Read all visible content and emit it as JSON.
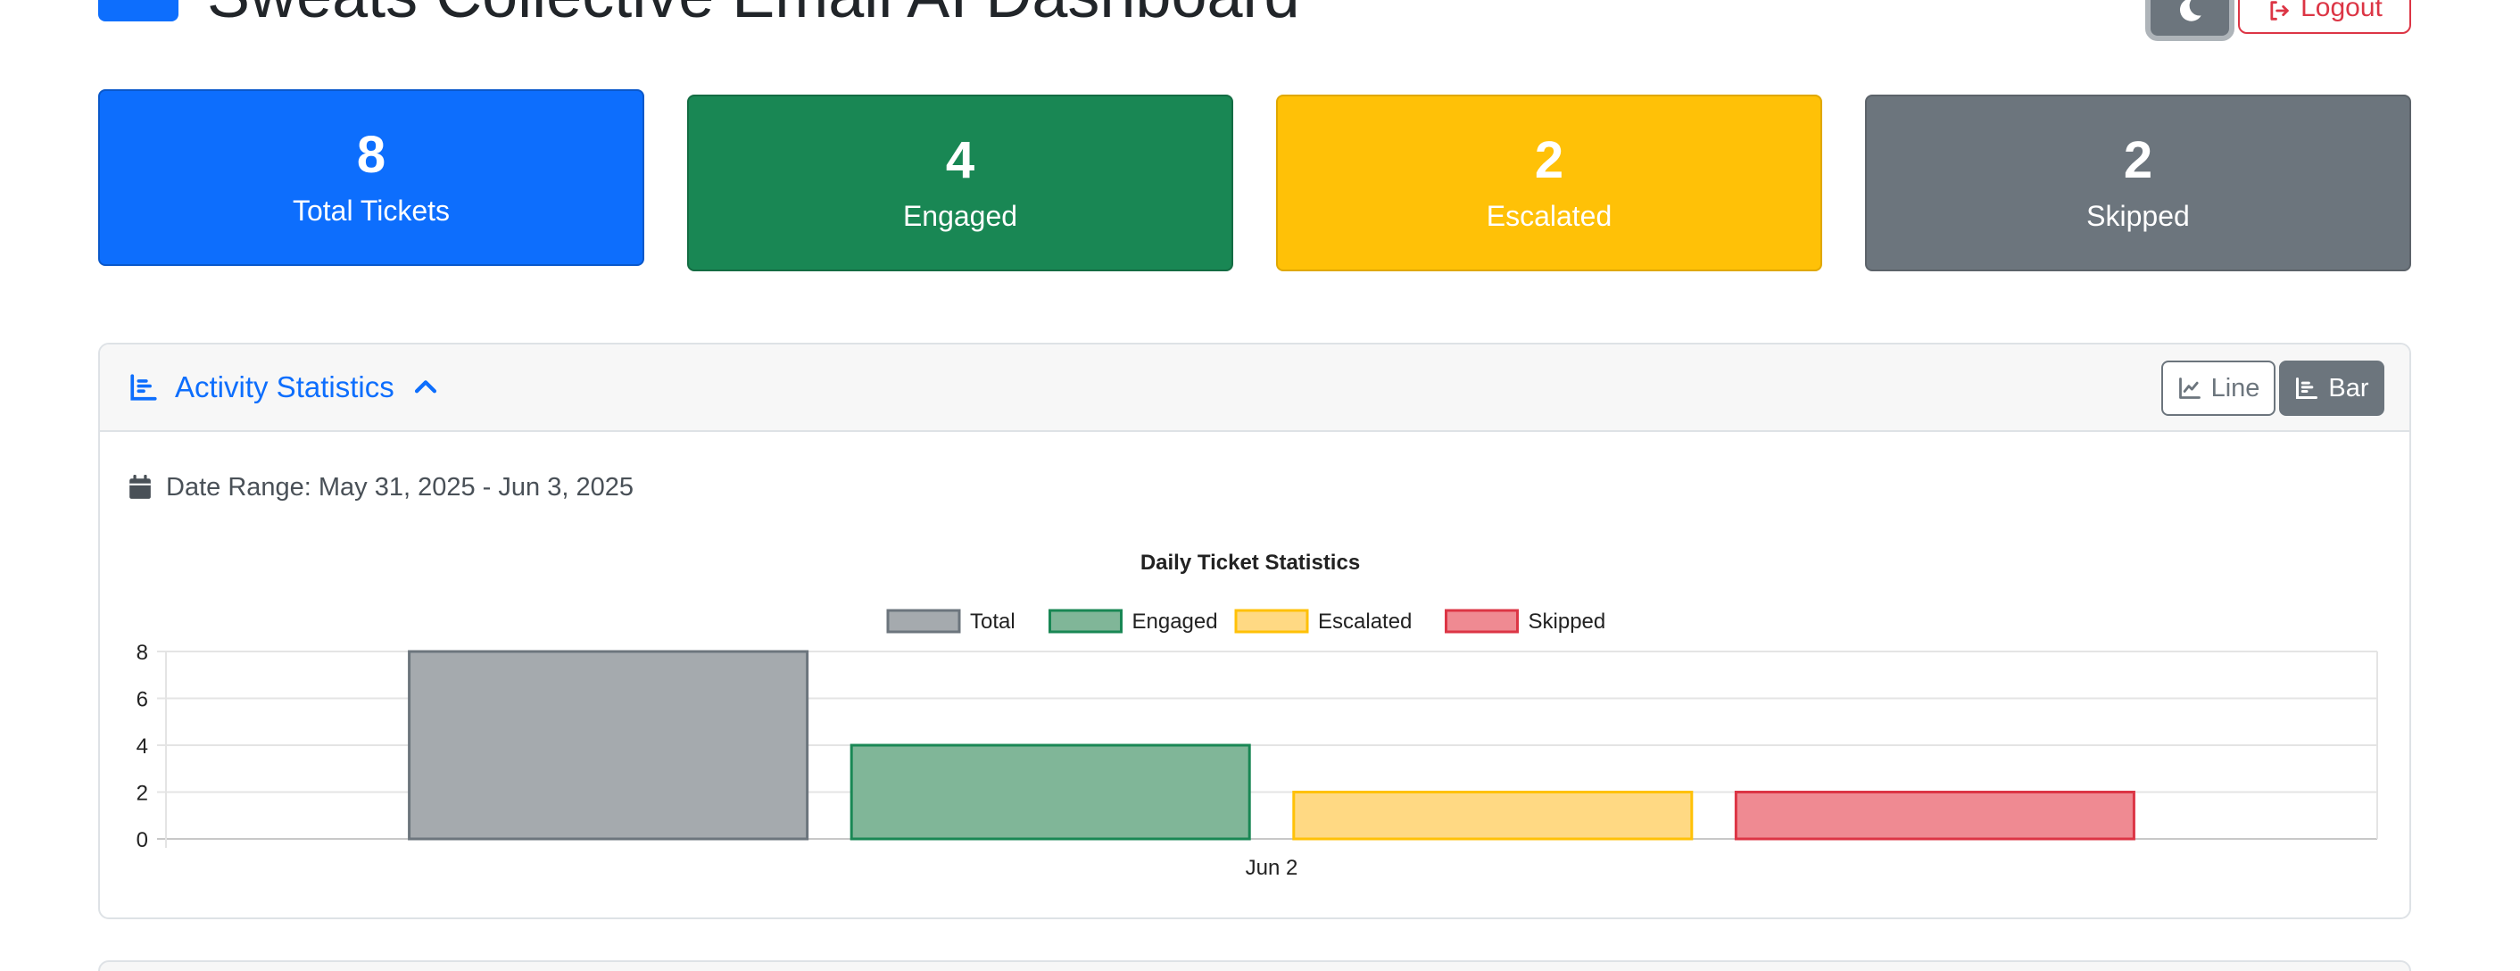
{
  "header": {
    "title": "Sweats Collective Email AI Dashboard",
    "logout_label": "Logout"
  },
  "stats": [
    {
      "value": "8",
      "label": "Total Tickets"
    },
    {
      "value": "4",
      "label": "Engaged"
    },
    {
      "value": "2",
      "label": "Escalated"
    },
    {
      "value": "2",
      "label": "Skipped"
    }
  ],
  "activity": {
    "title": "Activity Statistics",
    "line_label": "Line",
    "bar_label": "Bar",
    "date_range": "Date Range: May 31, 2025 - Jun 3, 2025"
  },
  "colors": {
    "primary": "#0d6efd",
    "success": "#198754",
    "warning": "#ffc107",
    "secondary": "#6c757d",
    "danger": "#dc3545"
  },
  "chart_data": {
    "type": "bar",
    "title": "Daily Ticket Statistics",
    "categories": [
      "Jun 2"
    ],
    "series": [
      {
        "name": "Total",
        "values": [
          8
        ],
        "fill": "#a5aaae",
        "stroke": "#6c757d"
      },
      {
        "name": "Engaged",
        "values": [
          4
        ],
        "fill": "#80b698",
        "stroke": "#198754"
      },
      {
        "name": "Escalated",
        "values": [
          2
        ],
        "fill": "#ffd983",
        "stroke": "#ffc107"
      },
      {
        "name": "Skipped",
        "values": [
          2
        ],
        "fill": "#ef8a92",
        "stroke": "#dc3545"
      }
    ],
    "yticks": [
      0,
      2,
      4,
      6,
      8
    ],
    "ylim": [
      0,
      8
    ],
    "legend": "top",
    "grid": true
  }
}
